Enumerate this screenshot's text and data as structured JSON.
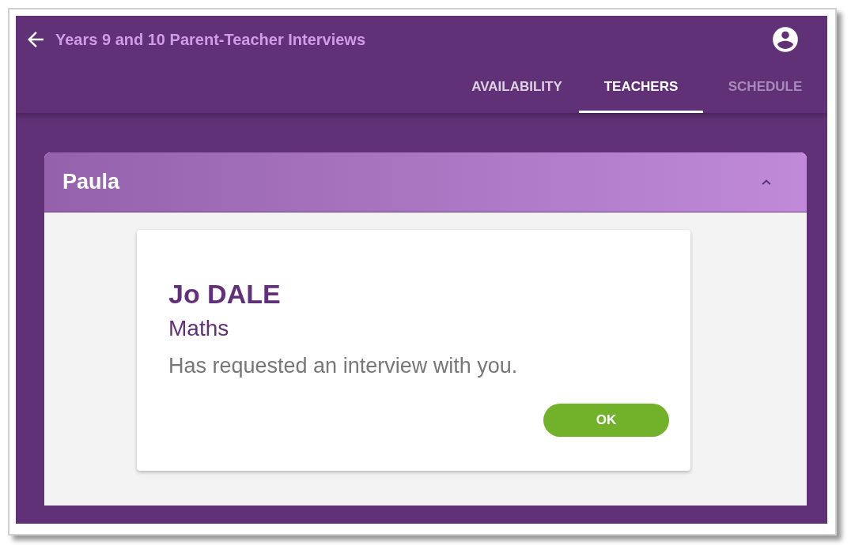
{
  "app_bar": {
    "title": "Years 9 and 10 Parent-Teacher Interviews"
  },
  "tabs": [
    {
      "label": "AVAILABILITY",
      "selected": false,
      "disabled": false
    },
    {
      "label": "TEACHERS",
      "selected": true,
      "disabled": false
    },
    {
      "label": "SCHEDULE",
      "selected": false,
      "disabled": true
    }
  ],
  "panel": {
    "title": "Paula",
    "expanded": true,
    "card": {
      "name": "Jo DALE",
      "subject": "Maths",
      "message": "Has requested an interview with you.",
      "button": "OK"
    }
  }
}
